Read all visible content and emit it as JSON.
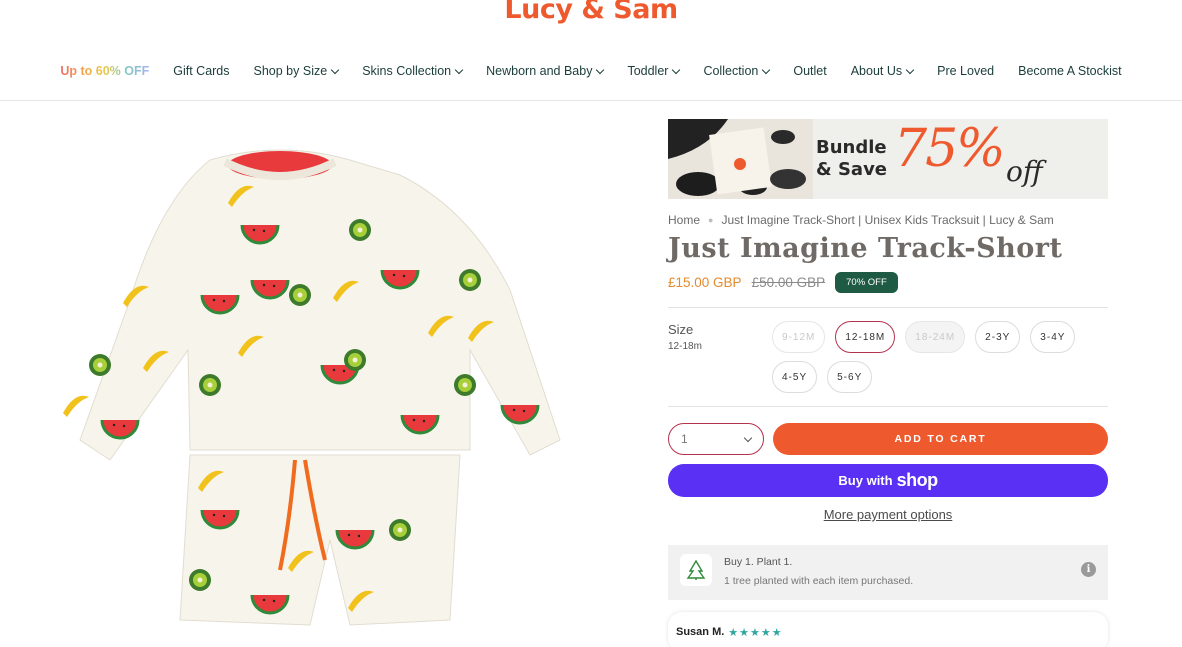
{
  "brand": {
    "logo_text": "Lucy & Sam"
  },
  "nav": {
    "items": [
      {
        "label": "Up to 60% OFF",
        "has_dropdown": false
      },
      {
        "label": "Gift Cards",
        "has_dropdown": false
      },
      {
        "label": "Shop by Size",
        "has_dropdown": true
      },
      {
        "label": "Skins Collection",
        "has_dropdown": true
      },
      {
        "label": "Newborn and Baby",
        "has_dropdown": true
      },
      {
        "label": "Toddler",
        "has_dropdown": true
      },
      {
        "label": "Collection",
        "has_dropdown": true
      },
      {
        "label": "Outlet",
        "has_dropdown": false
      },
      {
        "label": "About Us",
        "has_dropdown": true
      },
      {
        "label": "Pre Loved",
        "has_dropdown": false
      },
      {
        "label": "Become A Stockist",
        "has_dropdown": false
      }
    ]
  },
  "banner": {
    "line1": "Bundle",
    "line2": "& Save",
    "percent": "75%",
    "off": "off"
  },
  "breadcrumb": {
    "home": "Home",
    "current": "Just Imagine Track-Short | Unisex Kids Tracksuit | Lucy & Sam"
  },
  "product": {
    "title": "Just Imagine Track-Short",
    "price": "£15.00 GBP",
    "compare_price": "£50.00 GBP",
    "discount_badge": "70% OFF"
  },
  "size": {
    "label": "Size",
    "selected_value": "12-18m",
    "options": [
      {
        "label": "9-12M",
        "state": "disabled"
      },
      {
        "label": "12-18M",
        "state": "selected"
      },
      {
        "label": "18-24M",
        "state": "disabled"
      },
      {
        "label": "2-3Y",
        "state": "available"
      },
      {
        "label": "3-4Y",
        "state": "available"
      },
      {
        "label": "4-5Y",
        "state": "available"
      },
      {
        "label": "5-6Y",
        "state": "available"
      }
    ]
  },
  "cart": {
    "quantity": "1",
    "add_to_cart_label": "ADD TO CART",
    "buy_with_label": "Buy with",
    "shop_label": "shop",
    "more_payment_label": "More payment options"
  },
  "plant": {
    "title": "Buy 1. Plant 1.",
    "subtitle": "1 tree planted with each item purchased.",
    "info_glyph": "i"
  },
  "review": {
    "reviewer": "Susan M.",
    "stars": "★★★★★"
  },
  "colors": {
    "accent_orange": "#ee5a2e",
    "shop_purple": "#5a31f4",
    "badge_green": "#1f5a44",
    "selected_border": "#b4324d",
    "price_color": "#e38a2a"
  }
}
